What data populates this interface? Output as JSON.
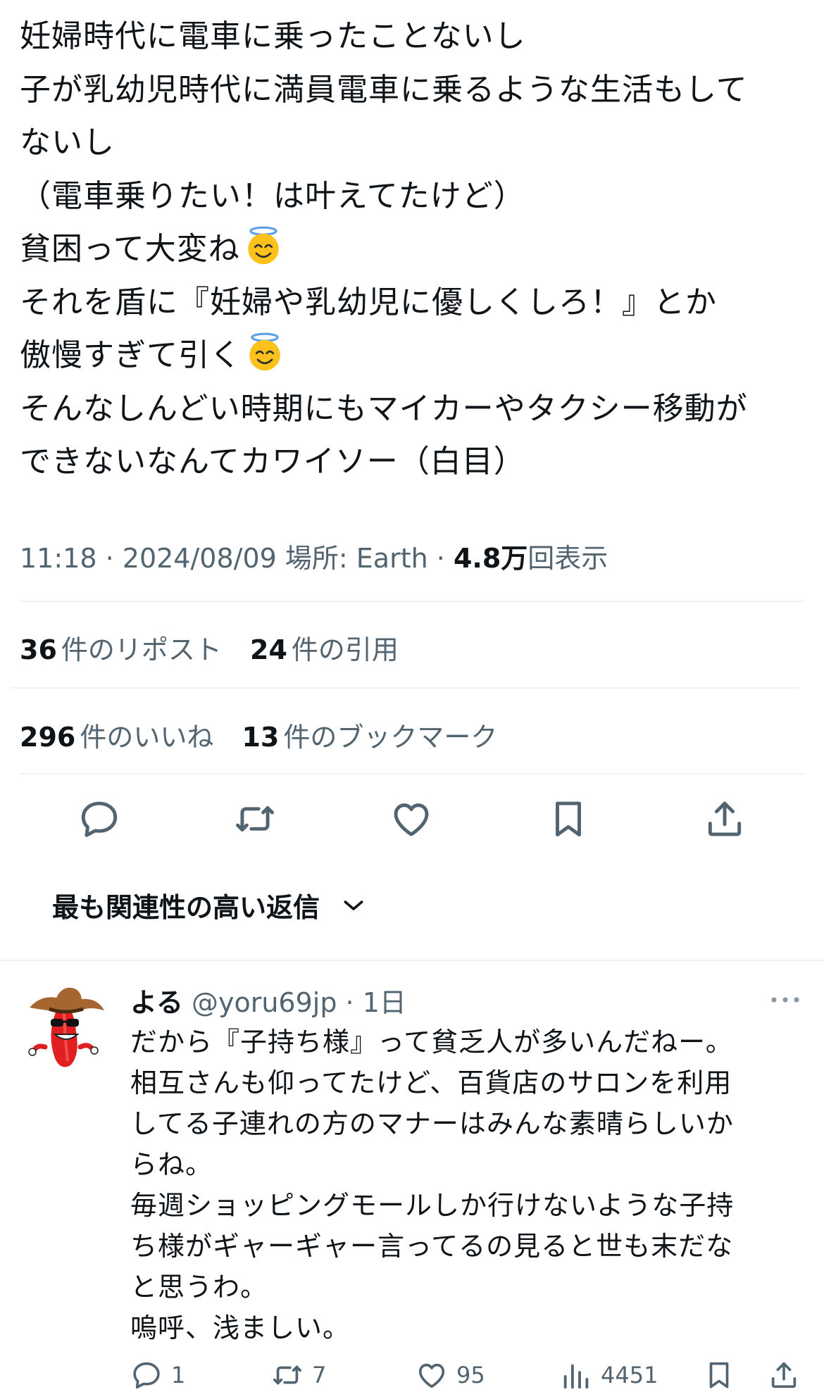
{
  "tweet": {
    "lines": [
      "妊婦時代に電車に乗ったことないし",
      "子が乳幼児時代に満員電車に乗るような生活もして",
      "ないし",
      "（電車乗りたい！は叶えてたけど）",
      "貧困って大変ね",
      "それを盾に『妊婦や乳幼児に優しくしろ！』とか",
      "傲慢すぎて引く",
      "そんなしんどい時期にもマイカーやタクシー移動が",
      "できないなんてカワイソー（白目）"
    ],
    "emoji": "smiling-face-with-halo"
  },
  "meta": {
    "time": "11:18",
    "date": "2024/08/09",
    "location": "場所: Earth",
    "views_count": "4.8万",
    "views_label": "回表示"
  },
  "stats": {
    "reposts": {
      "count": "36",
      "label": "件のリポスト"
    },
    "quotes": {
      "count": "24",
      "label": "件の引用"
    },
    "likes": {
      "count": "296",
      "label": "件のいいね"
    },
    "bookmarks": {
      "count": "13",
      "label": "件のブックマーク"
    }
  },
  "actions": [
    "reply-icon",
    "repost-icon",
    "like-icon",
    "bookmark-icon",
    "share-icon"
  ],
  "sort": {
    "label": "最も関連性の高い返信"
  },
  "reply": {
    "name": "よる",
    "handle": "@yoru69jp",
    "time": "1日",
    "lines": [
      "だから『子持ち様』って貧乏人が多いんだねー。",
      "相互さんも仰ってたけど、百貨店のサロンを利用",
      "してる子連れの方のマナーはみんな素晴らしいか",
      "らね。",
      "毎週ショッピングモールしか行けないような子持",
      "ち様がギャーギャー言ってるの見ると世も末だな",
      "と思うわ。",
      "嗚呼、浅ましい。"
    ],
    "counts": {
      "replies": "1",
      "reposts": "7",
      "likes": "95",
      "views": "4451"
    }
  },
  "colors": {
    "text": "#0f1419",
    "secondary": "#536471",
    "divider": "#eff3f4"
  }
}
